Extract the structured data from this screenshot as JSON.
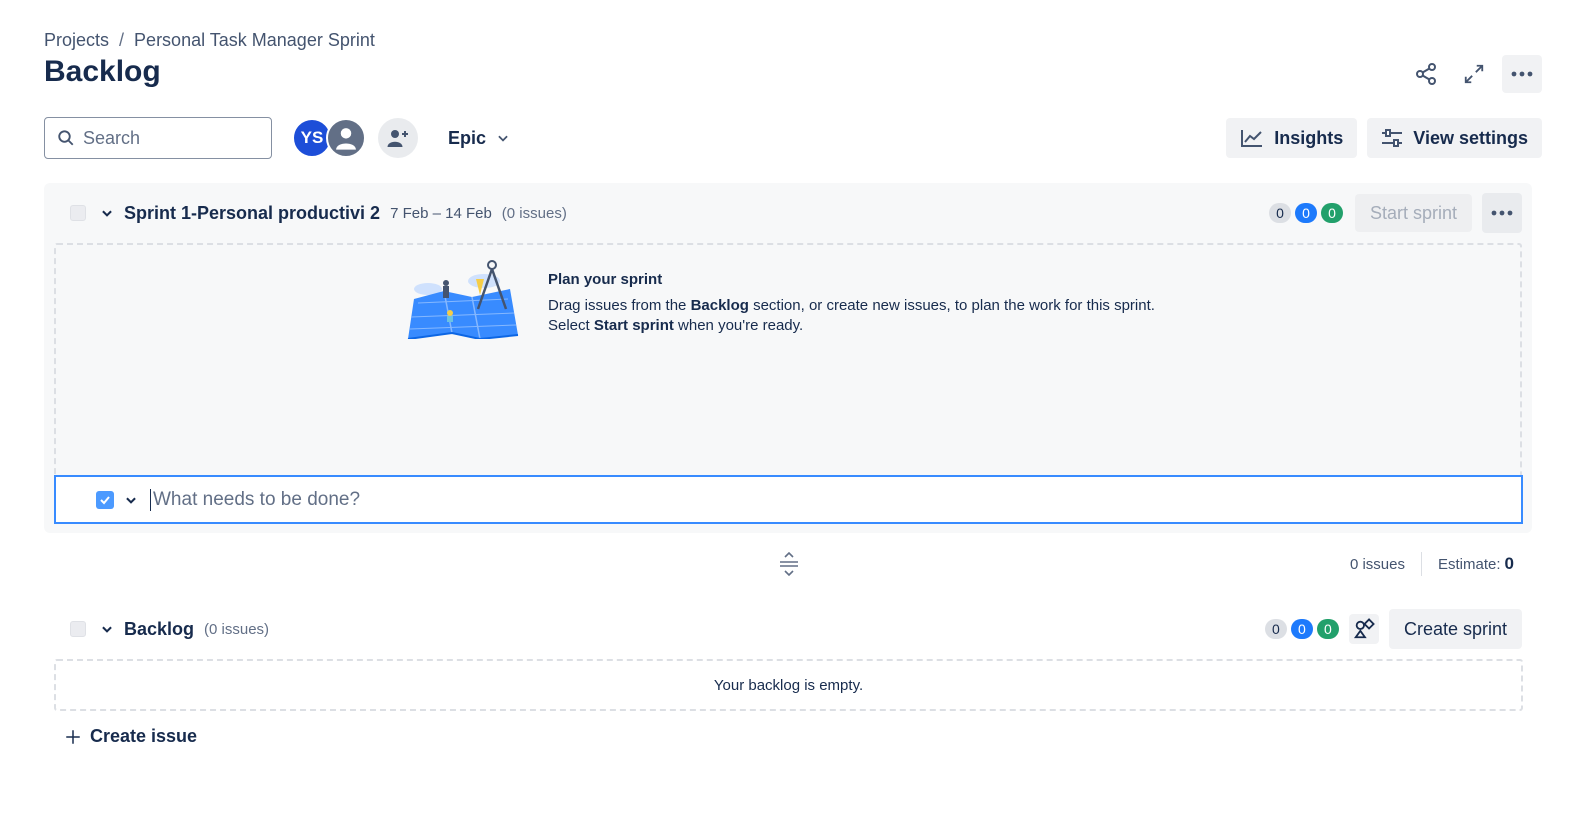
{
  "breadcrumb": {
    "root": "Projects",
    "separator": "/",
    "project": "Personal Task Manager Sprint"
  },
  "page": {
    "title": "Backlog"
  },
  "top_actions": {
    "icons": [
      "share-icon",
      "expand-icon",
      "more-icon"
    ]
  },
  "toolbar": {
    "search_placeholder": "Search",
    "avatar_initials": "YS",
    "epic_label": "Epic",
    "insights_label": "Insights",
    "view_settings_label": "View settings"
  },
  "sprint": {
    "name": "Sprint 1-Personal productivi 2",
    "dates": "7 Feb – 14 Feb",
    "issue_count": "(0 issues)",
    "status_counts": {
      "todo": "0",
      "in_progress": "0",
      "done": "0"
    },
    "start_label": "Start sprint",
    "plan_title": "Plan your sprint",
    "plan_line1_a": "Drag issues from the ",
    "plan_line1_b": "Backlog",
    "plan_line1_c": " section, or create new issues, to plan the work for this sprint.",
    "plan_line2_a": "Select ",
    "plan_line2_b": "Start sprint",
    "plan_line2_c": " when you're ready.",
    "create_placeholder": "What needs to be done?",
    "summary_issues": "0 issues",
    "estimate_label": "Estimate:",
    "estimate_value": "0"
  },
  "backlog": {
    "name": "Backlog",
    "issue_count": "(0 issues)",
    "status_counts": {
      "todo": "0",
      "in_progress": "0",
      "done": "0"
    },
    "create_sprint_label": "Create sprint",
    "empty_text": "Your backlog is empty.",
    "create_issue_label": "Create issue"
  },
  "colors": {
    "brand": "#1d4ed8",
    "focus_border": "#388bff",
    "pill_blue": "#1d7afc",
    "pill_green": "#22a06b"
  }
}
